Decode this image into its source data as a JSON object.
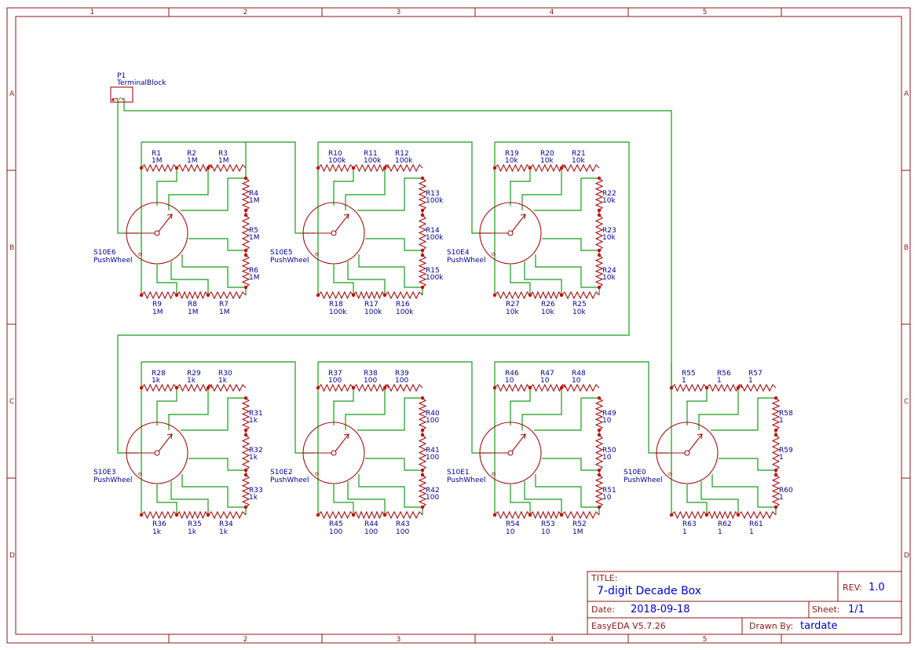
{
  "frame": {
    "columns": [
      "1",
      "2",
      "3",
      "4",
      "5"
    ],
    "rows": [
      "A",
      "B",
      "C",
      "D"
    ]
  },
  "connector": {
    "ref": "P1",
    "value": "TerminalBlock",
    "pins": [
      "1",
      "2"
    ]
  },
  "switches": [
    {
      "ref": "S10E6",
      "value": "PushWheel",
      "pos0": "0",
      "resistors": [
        {
          "ref": "R1",
          "value": "1M"
        },
        {
          "ref": "R2",
          "value": "1M"
        },
        {
          "ref": "R3",
          "value": "1M"
        },
        {
          "ref": "R4",
          "value": "1M"
        },
        {
          "ref": "R5",
          "value": "1M"
        },
        {
          "ref": "R6",
          "value": "1M"
        },
        {
          "ref": "R7",
          "value": "1M"
        },
        {
          "ref": "R8",
          "value": "1M"
        },
        {
          "ref": "R9",
          "value": "1M"
        }
      ]
    },
    {
      "ref": "S10E5",
      "value": "PushWheel",
      "pos0": "0",
      "resistors": [
        {
          "ref": "R10",
          "value": "100k"
        },
        {
          "ref": "R11",
          "value": "100k"
        },
        {
          "ref": "R12",
          "value": "100k"
        },
        {
          "ref": "R13",
          "value": "100k"
        },
        {
          "ref": "R14",
          "value": "100k"
        },
        {
          "ref": "R15",
          "value": "100k"
        },
        {
          "ref": "R16",
          "value": "100k"
        },
        {
          "ref": "R17",
          "value": "100k"
        },
        {
          "ref": "R18",
          "value": "100k"
        }
      ]
    },
    {
      "ref": "S10E4",
      "value": "PushWheel",
      "pos0": "0",
      "resistors": [
        {
          "ref": "R19",
          "value": "10k"
        },
        {
          "ref": "R20",
          "value": "10k"
        },
        {
          "ref": "R21",
          "value": "10k"
        },
        {
          "ref": "R22",
          "value": "10k"
        },
        {
          "ref": "R23",
          "value": "10k"
        },
        {
          "ref": "R24",
          "value": "10k"
        },
        {
          "ref": "R25",
          "value": "10k"
        },
        {
          "ref": "R26",
          "value": "10k"
        },
        {
          "ref": "R27",
          "value": "10k"
        }
      ]
    },
    {
      "ref": "S10E3",
      "value": "PushWheel",
      "pos0": "0",
      "resistors": [
        {
          "ref": "R28",
          "value": "1k"
        },
        {
          "ref": "R29",
          "value": "1k"
        },
        {
          "ref": "R30",
          "value": "1k"
        },
        {
          "ref": "R31",
          "value": "1k"
        },
        {
          "ref": "R32",
          "value": "1k"
        },
        {
          "ref": "R33",
          "value": "1k"
        },
        {
          "ref": "R34",
          "value": "1k"
        },
        {
          "ref": "R35",
          "value": "1k"
        },
        {
          "ref": "R36",
          "value": "1k"
        }
      ]
    },
    {
      "ref": "S10E2",
      "value": "PushWheel",
      "pos0": "0",
      "resistors": [
        {
          "ref": "R37",
          "value": "100"
        },
        {
          "ref": "R38",
          "value": "100"
        },
        {
          "ref": "R39",
          "value": "100"
        },
        {
          "ref": "R40",
          "value": "100"
        },
        {
          "ref": "R41",
          "value": "100"
        },
        {
          "ref": "R42",
          "value": "100"
        },
        {
          "ref": "R43",
          "value": "100"
        },
        {
          "ref": "R44",
          "value": "100"
        },
        {
          "ref": "R45",
          "value": "100"
        }
      ]
    },
    {
      "ref": "S10E1",
      "value": "PushWheel",
      "pos0": "0",
      "resistors": [
        {
          "ref": "R46",
          "value": "10"
        },
        {
          "ref": "R47",
          "value": "10"
        },
        {
          "ref": "R48",
          "value": "10"
        },
        {
          "ref": "R49",
          "value": "10"
        },
        {
          "ref": "R50",
          "value": "10"
        },
        {
          "ref": "R51",
          "value": "10"
        },
        {
          "ref": "R52",
          "value": "1M"
        },
        {
          "ref": "R53",
          "value": "10"
        },
        {
          "ref": "R54",
          "value": "10"
        }
      ]
    },
    {
      "ref": "S10E0",
      "value": "PushWheel",
      "pos0": "0",
      "resistors": [
        {
          "ref": "R55",
          "value": "1"
        },
        {
          "ref": "R56",
          "value": "1"
        },
        {
          "ref": "R57",
          "value": "1"
        },
        {
          "ref": "R58",
          "value": "1"
        },
        {
          "ref": "R59",
          "value": "1"
        },
        {
          "ref": "R60",
          "value": "1"
        },
        {
          "ref": "R61",
          "value": "1"
        },
        {
          "ref": "R62",
          "value": "1"
        },
        {
          "ref": "R63",
          "value": "1"
        }
      ]
    }
  ],
  "title_block": {
    "title_label": "TITLE:",
    "title": "7-digit Decade Box",
    "rev_label": "REV:",
    "rev": "1.0",
    "date_label": "Date:",
    "date": "2018-09-18",
    "sheet_label": "Sheet:",
    "sheet": "1/1",
    "tool": "EasyEDA V5.7.26",
    "drawn_by_label": "Drawn By:",
    "drawn_by": "tardate"
  },
  "colors": {
    "frame": "#8b1a1a",
    "wire": "#1a9a1a",
    "component": "#a01010",
    "junction": "#cc0000",
    "designator": "#000090",
    "title_value": "#0000cc"
  }
}
